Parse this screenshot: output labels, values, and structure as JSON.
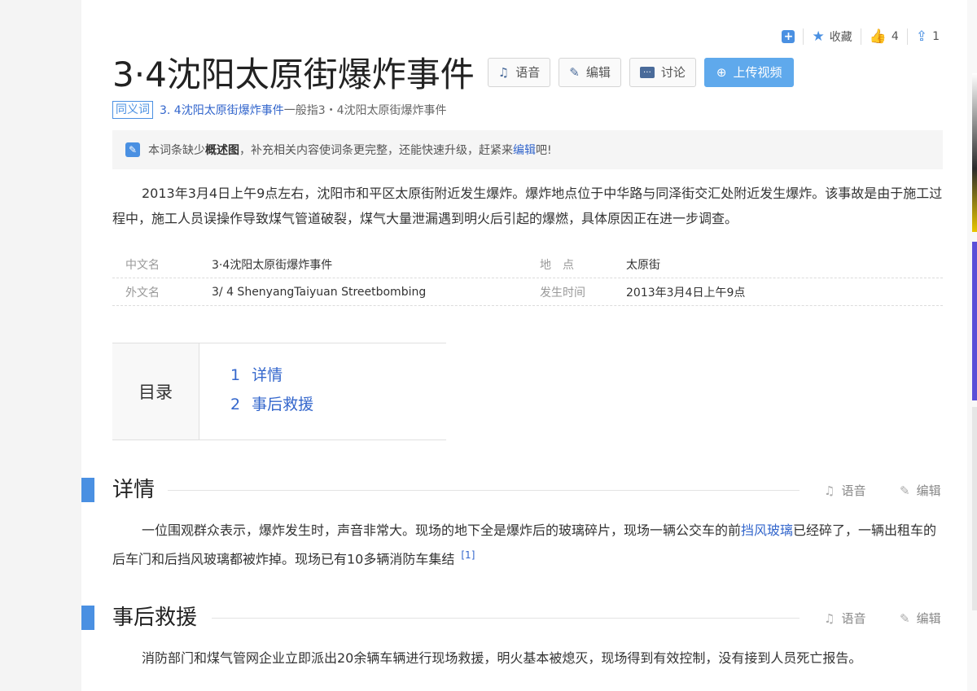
{
  "topbar": {
    "collect_label": "收藏",
    "like_count": "4",
    "share_count": "1"
  },
  "title": "3·4沈阳太原街爆炸事件",
  "title_buttons": {
    "voice": "语音",
    "edit": "编辑",
    "discuss": "讨论",
    "upload_video": "上传视频"
  },
  "synonym": {
    "tag": "同义词",
    "link_text": "3. 4沈阳太原街爆炸事件",
    "middle": "一般指",
    "target": "3・4沈阳太原街爆炸事件"
  },
  "notice": {
    "prefix": "本词条缺少",
    "bold": "概述图",
    "middle": "，补充相关内容使词条更完整，还能快速升级，赶紧来",
    "link": "编辑",
    "suffix": "吧!"
  },
  "summary": "2013年3月4日上午9点左右，沈阳市和平区太原街附近发生爆炸。爆炸地点位于中华路与同泽街交汇处附近发生爆炸。该事故是由于施工过程中，施工人员误操作导致煤气管道破裂，煤气大量泄漏遇到明火后引起的爆燃，具体原因正在进一步调查。",
  "basic_info": [
    {
      "k1": "中文名",
      "v1": "3·4沈阳太原街爆炸事件",
      "k2": "地　点",
      "v2": "太原街"
    },
    {
      "k1": "外文名",
      "v1": "3/ 4 ShenyangTaiyuan Streetbombing",
      "k2": "发生时间",
      "v2": "2013年3月4日上午9点"
    }
  ],
  "toc": {
    "heading": "目录",
    "items": [
      {
        "num": "1",
        "label": "详情"
      },
      {
        "num": "2",
        "label": "事后救援"
      }
    ]
  },
  "sections": [
    {
      "title": "详情",
      "voice": "语音",
      "edit": "编辑",
      "text_a": "一位围观群众表示，爆炸发生时，声音非常大。现场的地下全是爆炸后的玻璃碎片，现场一辆公交车的前",
      "link": "挡风玻璃",
      "text_b": "已经碎了，一辆出租车的后车门和后挡风玻璃都被炸掉。现场已有10多辆消防车集结",
      "ref": "[1]"
    },
    {
      "title": "事后救援",
      "voice": "语音",
      "edit": "编辑",
      "text": "消防部门和煤气管网企业立即派出20余辆车辆进行现场救援，明火基本被熄灭，现场得到有效控制，没有接到人员死亡报告。"
    }
  ]
}
